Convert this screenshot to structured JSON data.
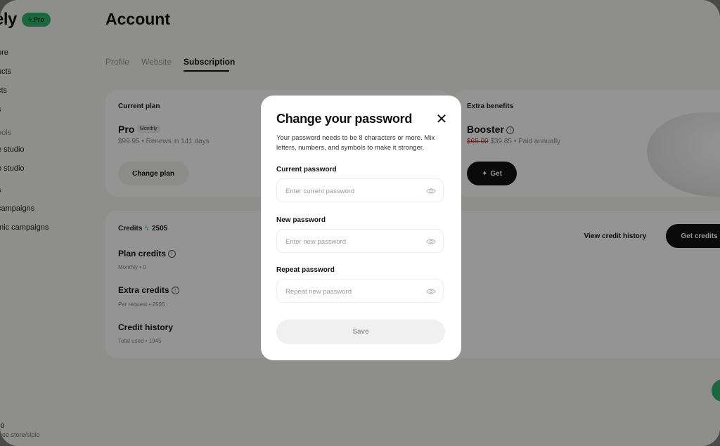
{
  "brand": {
    "logo_text": "ely",
    "badge": "Pro"
  },
  "sidebar": {
    "items": [
      {
        "label": "ore",
        "muted": false
      },
      {
        "label": "ucts",
        "muted": false
      },
      {
        "label": "cts",
        "muted": false
      },
      {
        "label": "s",
        "muted": false
      },
      {
        "label": "ools",
        "muted": true
      },
      {
        "label": "e studio",
        "muted": false
      },
      {
        "label": "o studio",
        "muted": false
      },
      {
        "label": "s",
        "muted": false
      },
      {
        "label": "campaigns",
        "muted": false
      },
      {
        "label": "mic campaigns",
        "muted": false
      }
    ],
    "footer_name": "lo",
    "footer_url": "bee.store/slplo"
  },
  "page": {
    "title": "Account",
    "tabs": [
      {
        "label": "Profile",
        "active": false
      },
      {
        "label": "Website",
        "active": false
      },
      {
        "label": "Subscription",
        "active": true
      }
    ]
  },
  "current_plan": {
    "label": "Current plan",
    "name": "Pro",
    "tag": "Monthly",
    "meta": "$99.95 • Renews in 141 days",
    "button": "Change plan"
  },
  "extra_benefits": {
    "label": "Extra benefits",
    "name": "Booster",
    "old_price": "$65.00",
    "meta": " $39.85 • Paid annually",
    "button": "Get"
  },
  "credits": {
    "label": "Credits",
    "value": "2505",
    "view_history": "View credit history",
    "get_credits": "Get credits",
    "rows": [
      {
        "title": "Plan credits",
        "sub": "Monthly • 0",
        "info": true
      },
      {
        "title": "Extra credits",
        "sub": "Per request • 2505",
        "info": true
      },
      {
        "title": "Credit history",
        "sub": "Total used • 1945",
        "info": false
      }
    ]
  },
  "modal": {
    "title": "Change your password",
    "description": "Your password needs to be 8 characters or more. Mix letters, numbers, and symbols to make it stronger.",
    "fields": [
      {
        "label": "Current password",
        "placeholder": "Enter current password",
        "value": ""
      },
      {
        "label": "New password",
        "placeholder": "Enter new password",
        "value": ""
      },
      {
        "label": "Repeat password",
        "placeholder": "Repeat new password",
        "value": ""
      }
    ],
    "save_label": "Save",
    "close_icon": "close-icon",
    "eye_icon": "eye-icon"
  },
  "colors": {
    "accent_green": "#2fb36c",
    "dark": "#111111",
    "overlay": "rgba(0,0,0,0.42)"
  }
}
